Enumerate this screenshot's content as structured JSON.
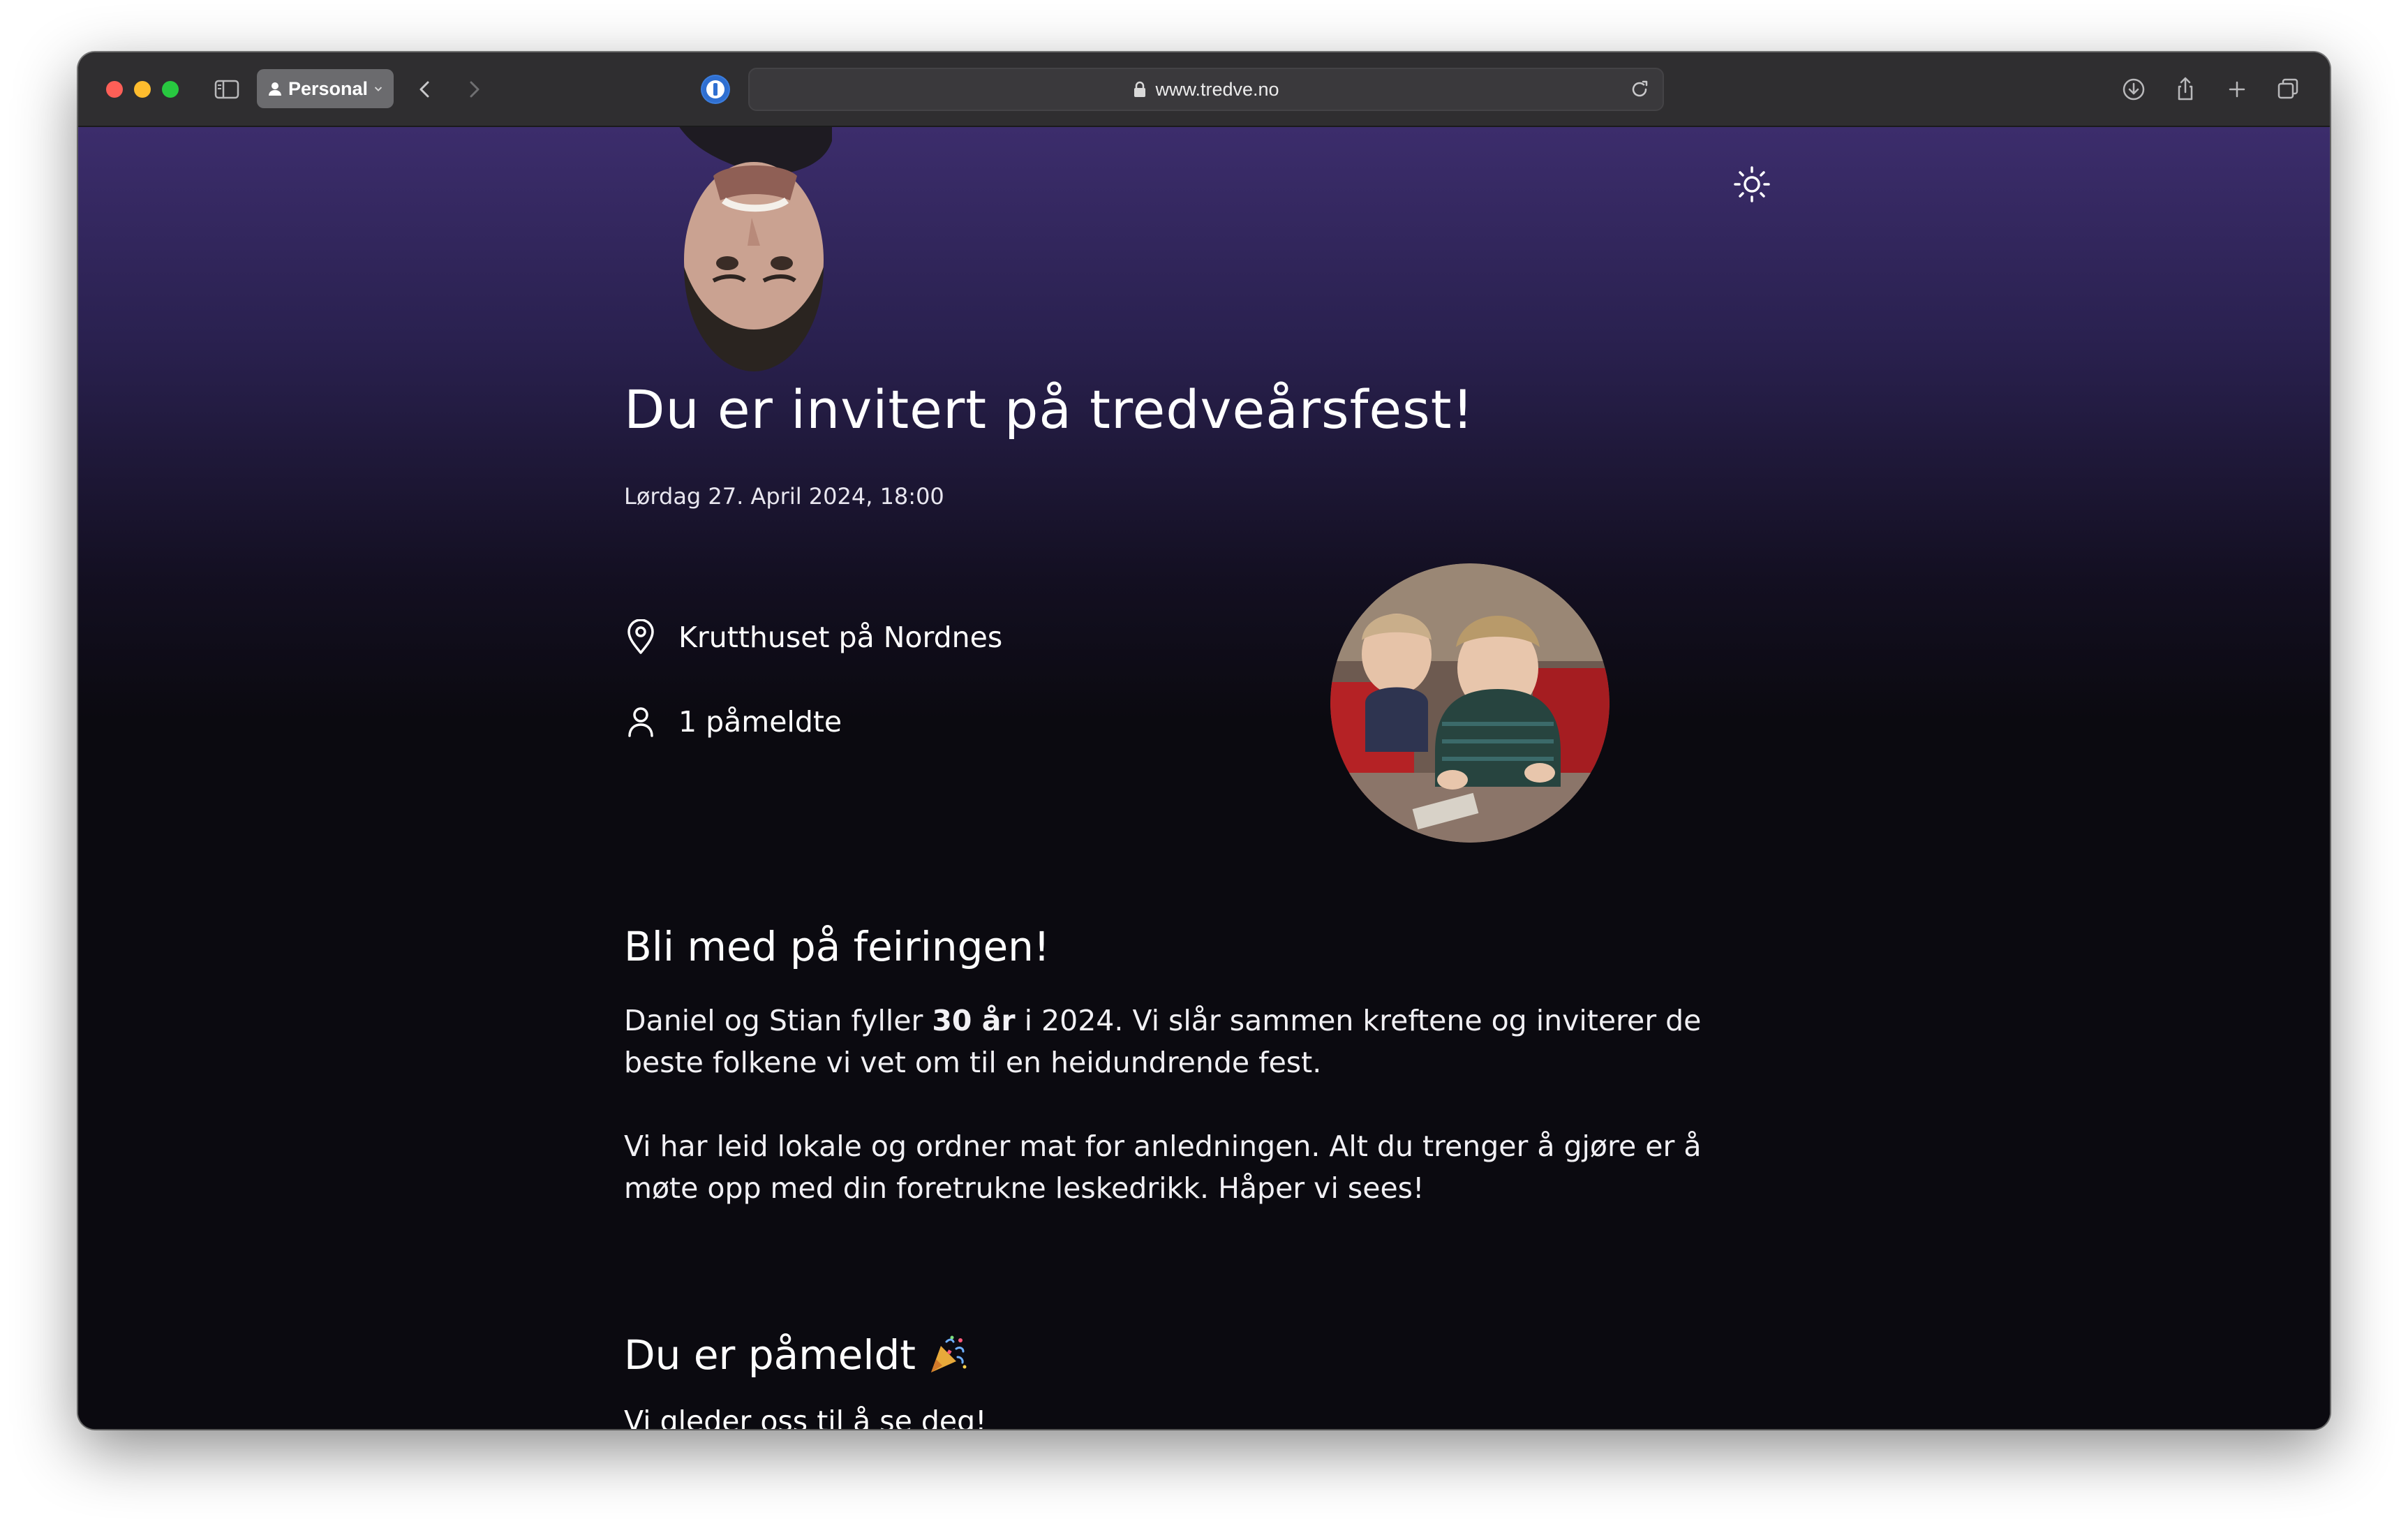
{
  "browser": {
    "profile_label": "Personal",
    "url": "www.tredve.no"
  },
  "page": {
    "title": "Du er invitert på tredveårsfest!",
    "datetime": "Lørdag 27. April 2024, 18:00",
    "location": "Krutthuset på Nordnes",
    "attendees": "1 påmeldte",
    "section_heading": "Bli med på feiringen!",
    "para1_a": "Daniel og Stian fyller ",
    "para1_bold": "30 år",
    "para1_b": " i 2024. Vi slår sammen kreftene og inviterer de beste folkene vi vet om til en heidundrende fest.",
    "para2": "Vi har leid lokale og ordner mat for anledningen. Alt du trenger å gjøre er å møte opp med din foretrukne leskedrikk. Håper vi sees!",
    "registered_heading": "Du er påmeldt",
    "registered_sub": "Vi gleder oss til å se deg!"
  },
  "icons": {
    "theme": "sun-icon",
    "location": "map-pin-icon",
    "attendees": "user-icon",
    "celebration": "party-popper-icon"
  },
  "colors": {
    "gradient_top": "#3c2d6c",
    "background": "#0b0a10",
    "text": "#ffffff"
  }
}
